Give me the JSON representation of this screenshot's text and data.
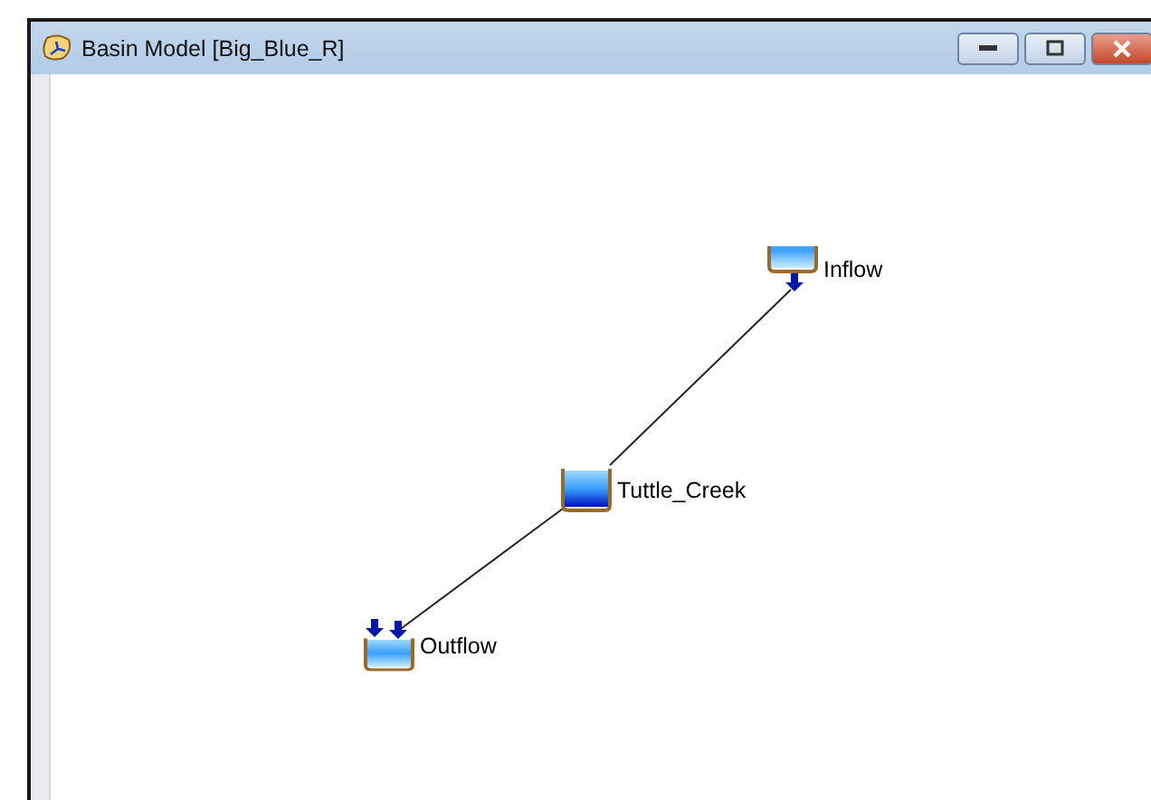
{
  "window": {
    "title": "Basin Model [Big_Blue_R]"
  },
  "nodes": [
    {
      "kind": "source",
      "name": "Inflow",
      "linked_to_next": true
    },
    {
      "kind": "reservoir",
      "name": "Tuttle_Creek",
      "linked_to_next": true
    },
    {
      "kind": "sink",
      "name": "Outflow",
      "linked_to_next": false
    }
  ]
}
